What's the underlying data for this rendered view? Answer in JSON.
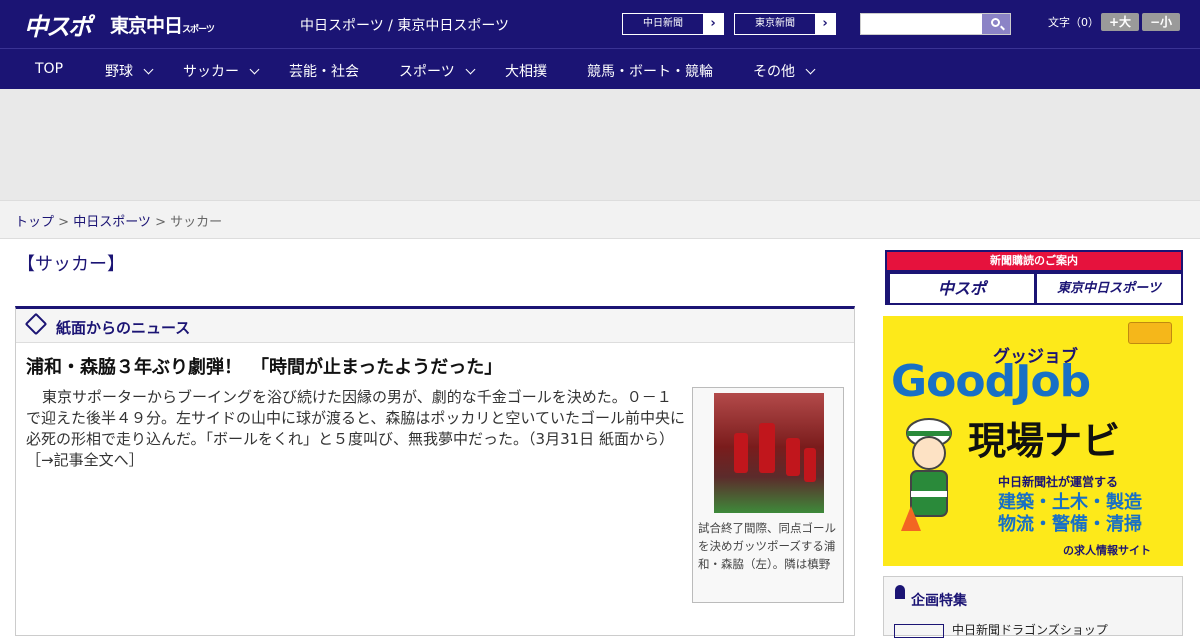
{
  "header": {
    "logo_chuspo": "中スポ",
    "logo_tokyo": "東京中日",
    "logo_tokyo_small": "スポーツ",
    "site_name": "中日スポーツ / 東京中日スポーツ",
    "paper_buttons": [
      "中日新聞",
      "東京新聞"
    ],
    "search_placeholder": "",
    "font_label": "文字（0）",
    "font_bigger": "+大",
    "font_smaller": "−小"
  },
  "nav": {
    "items": [
      {
        "label": "TOP",
        "dropdown": false
      },
      {
        "label": "野球",
        "dropdown": true
      },
      {
        "label": "サッカー",
        "dropdown": true
      },
      {
        "label": "芸能・社会",
        "dropdown": false
      },
      {
        "label": "スポーツ",
        "dropdown": true
      },
      {
        "label": "大相撲",
        "dropdown": false
      },
      {
        "label": "競馬・ボート・競輪",
        "dropdown": false
      },
      {
        "label": "その他",
        "dropdown": true
      }
    ]
  },
  "breadcrumb": {
    "top": "トップ",
    "sep": " > ",
    "chunichi": "中日スポーツ",
    "current": "サッカー"
  },
  "category_title": "【サッカー】",
  "news": {
    "section_label": "紙面からのニュース",
    "headline": "浦和・森脇３年ぶり劇弾！　「時間が止まったようだった」",
    "body": "東京サポーターからブーイングを浴び続けた因縁の男が、劇的な千金ゴールを決めた。０－１で迎えた後半４９分。左サイドの山中に球が渡ると、森脇はポッカリと空いていたゴール前中央に必死の形相で走り込んだ。「ボールをくれ」と５度叫び、無我夢中だった。（3月31日 紙面から）",
    "more_link": "［→記事全文へ］",
    "caption": "試合終了間際、同点ゴールを決めガッツポーズする浦和・森脇（左）。隣は槙野"
  },
  "sidebar": {
    "subscribe_bar": "新聞購読のご案内",
    "subscribe_chuspo": "中スポ",
    "subscribe_tokyo": "東京中日スポーツ",
    "goodjob_kana": "グッジョブ",
    "goodjob_title": "GoodJob",
    "goodjob_sub": "現場ナビ",
    "goodjob_operator": "中日新聞社が運営する",
    "goodjob_fields1": "建築・土木・製造",
    "goodjob_fields2": "物流・警備・清掃",
    "goodjob_tail": "の求人情報サイト",
    "special_label": "企画特集",
    "special_item": "中日新聞ドラゴンズショップ"
  },
  "colors": {
    "brand_navy": "#1b1474",
    "ad_yellow": "#fde91a",
    "ad_red": "#e6123d",
    "ad_blue": "#1870c5"
  }
}
